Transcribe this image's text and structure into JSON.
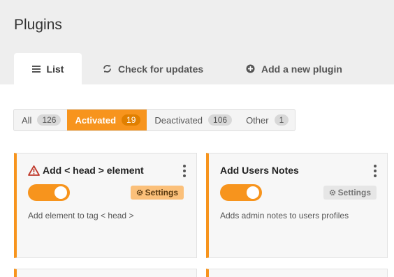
{
  "header": {
    "title": "Plugins"
  },
  "tabs": [
    {
      "label": "List",
      "icon": "list-icon",
      "active": true
    },
    {
      "label": "Check for updates",
      "icon": "refresh-icon"
    },
    {
      "label": "Add a new plugin",
      "icon": "plus-circle-icon"
    }
  ],
  "filters": [
    {
      "label": "All",
      "count": "126"
    },
    {
      "label": "Activated",
      "count": "19",
      "active": true
    },
    {
      "label": "Deactivated",
      "count": "106"
    },
    {
      "label": "Other",
      "count": "1"
    }
  ],
  "plugins": [
    {
      "title": "Add < head > element",
      "warning": true,
      "settings_label": "Settings",
      "description": "Add element to tag < head >",
      "enabled": true
    },
    {
      "title": "Add Users Notes",
      "warning": false,
      "settings_label": "Settings",
      "description": "Adds admin notes to users profiles",
      "enabled": true
    }
  ],
  "colors": {
    "accent": "#f7941d",
    "header_bg": "#eeeeee",
    "card_bg": "#f7f7f7",
    "warning": "#c0392b"
  }
}
